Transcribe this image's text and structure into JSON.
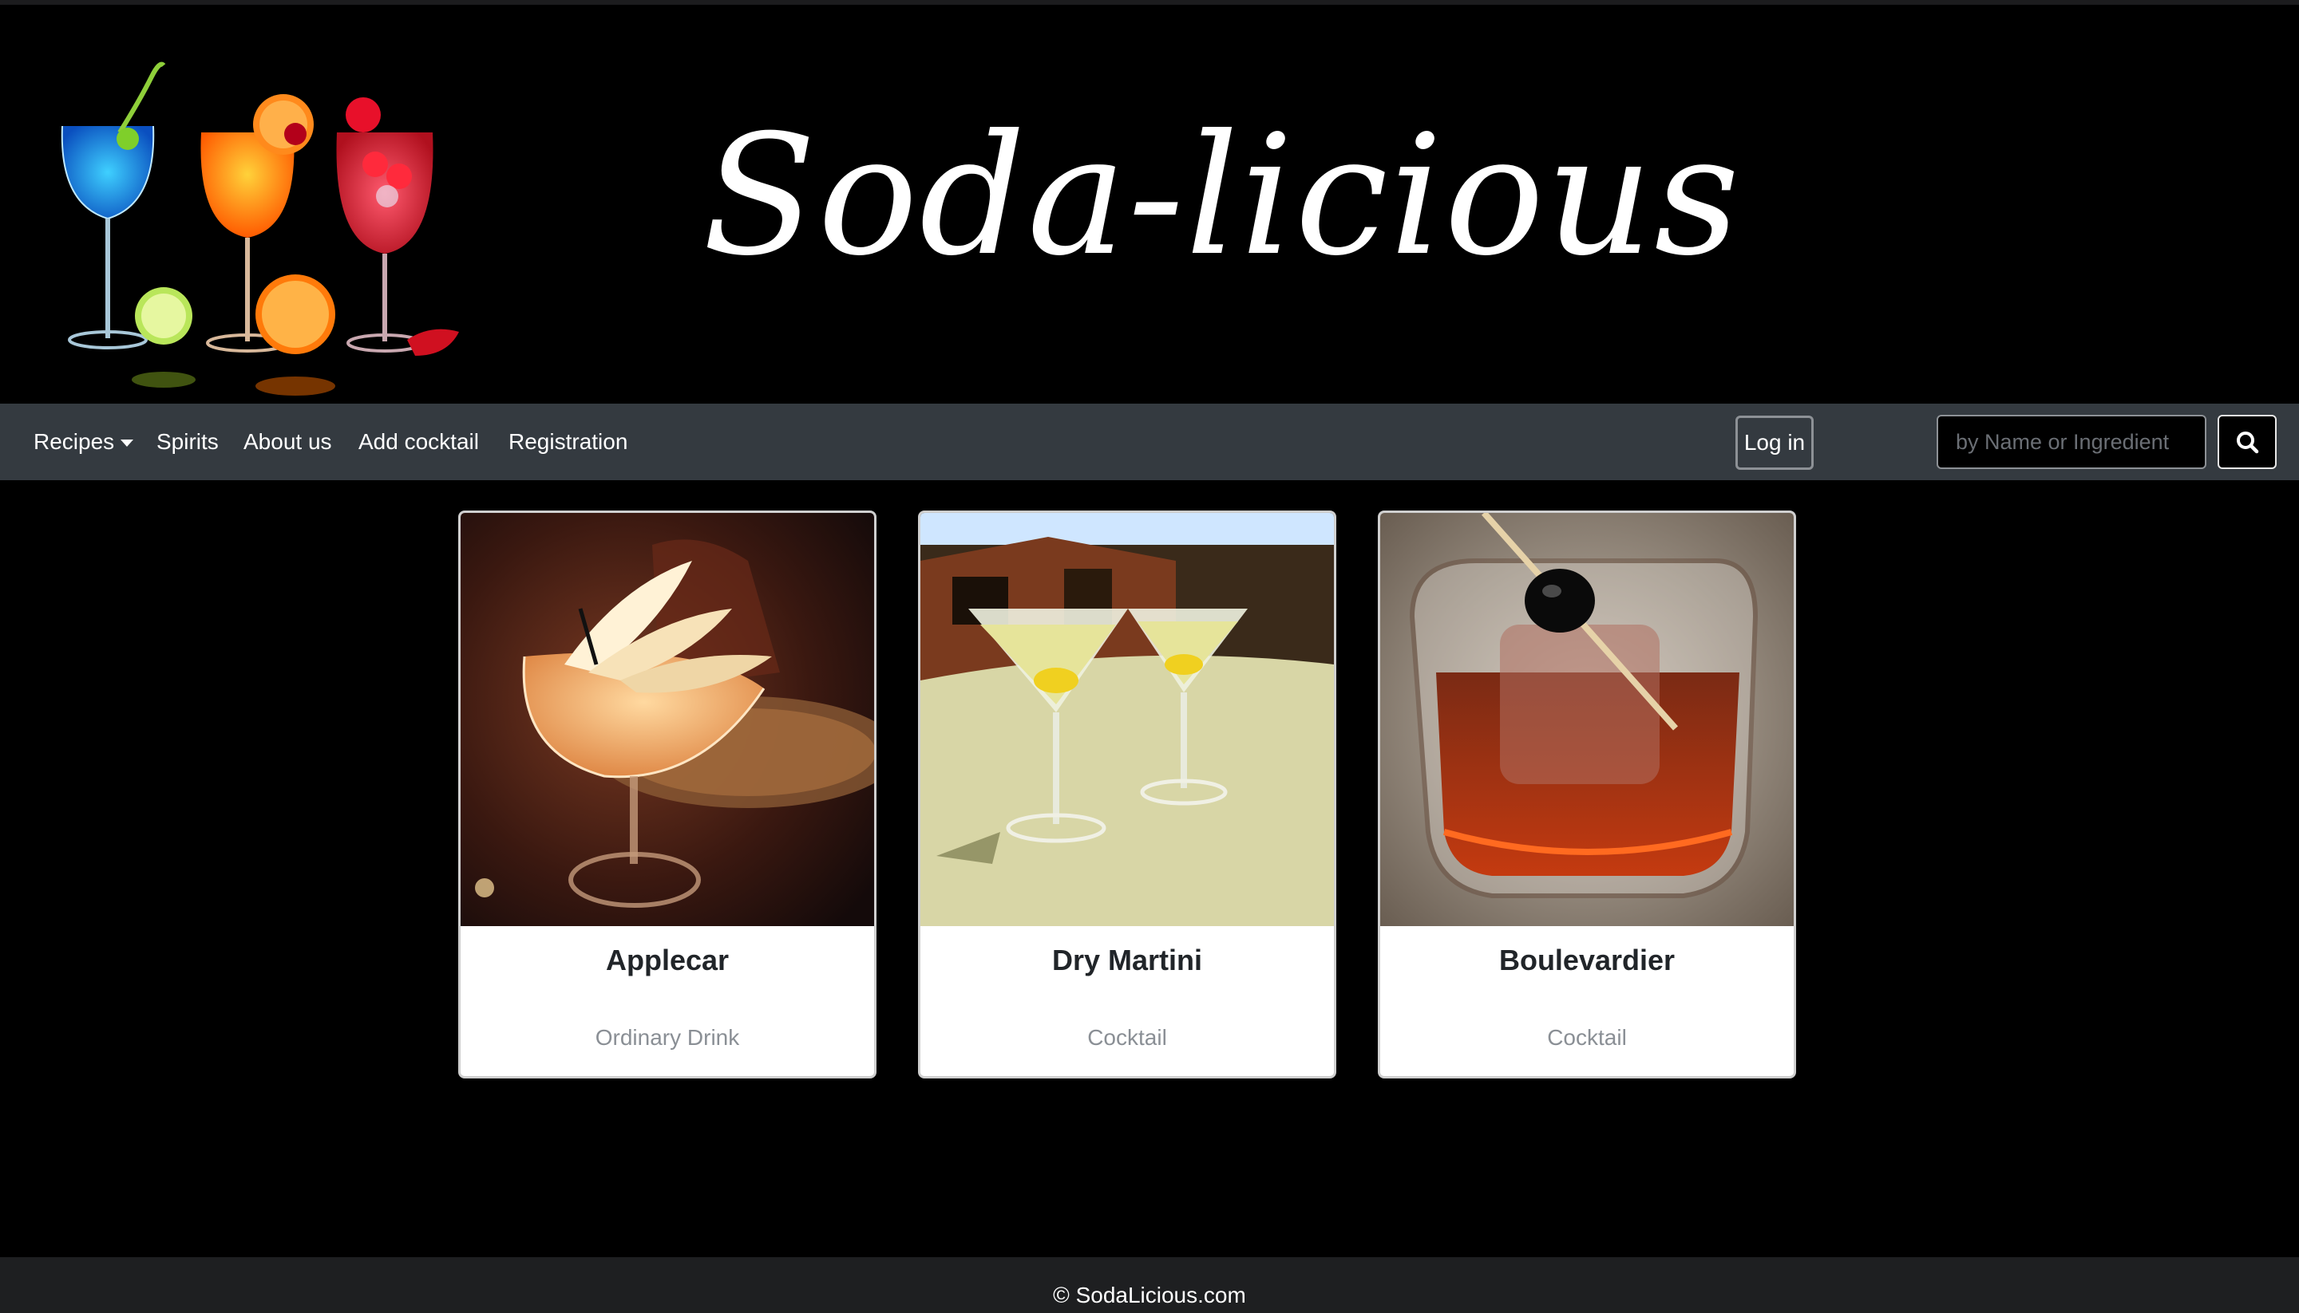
{
  "brand": {
    "title": "Soda-licious"
  },
  "nav": {
    "recipes": "Recipes",
    "spirits": "Spirits",
    "about": "About us",
    "add_cocktail": "Add cocktail",
    "registration": "Registration",
    "login": "Log in"
  },
  "search": {
    "placeholder": "by Name or Ingredient",
    "value": ""
  },
  "icons": {
    "search": "search-icon",
    "dropdown": "caret-down-icon"
  },
  "cards": [
    {
      "name": "Applecar",
      "category": "Ordinary Drink"
    },
    {
      "name": "Dry Martini",
      "category": "Cocktail"
    },
    {
      "name": "Boulevardier",
      "category": "Cocktail"
    }
  ],
  "footer": {
    "copyright": "© SodaLicious.com"
  },
  "colors": {
    "navbar": "#343a40",
    "background": "#000000",
    "footer": "#1e1f21",
    "card": "#ffffff"
  }
}
